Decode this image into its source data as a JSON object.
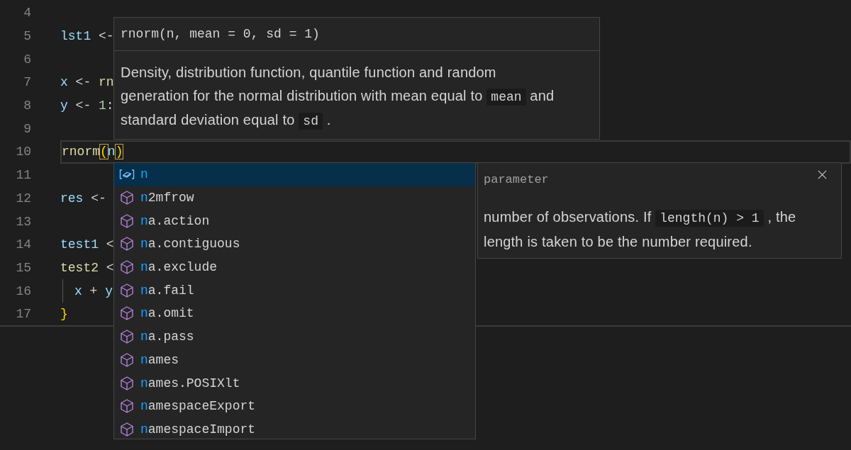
{
  "editor": {
    "lines": [
      {
        "number": "4",
        "current": false,
        "indent": false
      },
      {
        "number": "5",
        "current": false,
        "indent": false,
        "tokens": [
          {
            "text": "lst1",
            "kind": "variable"
          },
          {
            "text": " <-",
            "kind": "operator"
          }
        ]
      },
      {
        "number": "6",
        "current": false,
        "indent": false
      },
      {
        "number": "7",
        "current": false,
        "indent": false,
        "tokens": [
          {
            "text": "x",
            "kind": "variable"
          },
          {
            "text": " <- ",
            "kind": "operator"
          },
          {
            "text": "rn",
            "kind": "function"
          }
        ]
      },
      {
        "number": "8",
        "current": false,
        "indent": false,
        "tokens": [
          {
            "text": "y",
            "kind": "variable"
          },
          {
            "text": " <- ",
            "kind": "operator"
          },
          {
            "text": "1",
            "kind": "number"
          },
          {
            "text": ":",
            "kind": "operator"
          }
        ]
      },
      {
        "number": "9",
        "current": false,
        "indent": false
      },
      {
        "number": "10",
        "current": true,
        "indent": false,
        "tokens": [
          {
            "text": "rnorm",
            "kind": "function"
          },
          {
            "text": "(",
            "kind": "match"
          },
          {
            "text": "n",
            "kind": "variable"
          },
          {
            "text": ")",
            "kind": "match"
          }
        ]
      },
      {
        "number": "11",
        "current": false,
        "indent": false
      },
      {
        "number": "12",
        "current": false,
        "indent": false,
        "tokens": [
          {
            "text": "res",
            "kind": "variable"
          },
          {
            "text": " <-",
            "kind": "operator"
          }
        ]
      },
      {
        "number": "13",
        "current": false,
        "indent": false
      },
      {
        "number": "14",
        "current": false,
        "indent": false,
        "tokens": [
          {
            "text": "test1",
            "kind": "variable"
          },
          {
            "text": " <",
            "kind": "operator"
          }
        ]
      },
      {
        "number": "15",
        "current": false,
        "indent": false,
        "tokens": [
          {
            "text": "test2",
            "kind": "function"
          },
          {
            "text": " <",
            "kind": "operator"
          }
        ]
      },
      {
        "number": "16",
        "current": false,
        "indent": true,
        "tokens": [
          {
            "text": "x",
            "kind": "variable"
          },
          {
            "text": " + ",
            "kind": "operator"
          },
          {
            "text": "y",
            "kind": "variable"
          }
        ]
      },
      {
        "number": "17",
        "current": false,
        "indent": false,
        "tokens": [
          {
            "text": "}",
            "kind": "brace"
          }
        ]
      }
    ]
  },
  "hover": {
    "signature": "rnorm(n, mean = 0, sd = 1)",
    "doc_lines": [
      [
        {
          "kind": "text",
          "text": "Density, distribution function, quantile function and random"
        }
      ],
      [
        {
          "kind": "text",
          "text": "generation for the normal distribution with mean equal to"
        },
        {
          "kind": "code",
          "text": "mean"
        },
        {
          "kind": "text",
          "text": "and"
        }
      ],
      [
        {
          "kind": "text",
          "text": "standard deviation equal to"
        },
        {
          "kind": "code",
          "text": "sd"
        },
        {
          "kind": "text",
          "text": "."
        }
      ]
    ]
  },
  "suggestions": [
    {
      "kind": "variable",
      "match": "n",
      "selected": true
    },
    {
      "kind": "module",
      "match": "n",
      "rest": "2mfrow",
      "selected": false
    },
    {
      "kind": "module",
      "match": "n",
      "rest": "a.action",
      "selected": false
    },
    {
      "kind": "module",
      "match": "n",
      "rest": "a.contiguous",
      "selected": false
    },
    {
      "kind": "module",
      "match": "n",
      "rest": "a.exclude",
      "selected": false
    },
    {
      "kind": "module",
      "match": "n",
      "rest": "a.fail",
      "selected": false
    },
    {
      "kind": "module",
      "match": "n",
      "rest": "a.omit",
      "selected": false
    },
    {
      "kind": "module",
      "match": "n",
      "rest": "a.pass",
      "selected": false
    },
    {
      "kind": "module",
      "match": "n",
      "rest": "ames",
      "selected": false
    },
    {
      "kind": "module",
      "match": "n",
      "rest": "ames.POSIXlt",
      "selected": false
    },
    {
      "kind": "module",
      "match": "n",
      "rest": "amespaceExport",
      "selected": false
    },
    {
      "kind": "module",
      "match": "n",
      "rest": "amespaceImport",
      "selected": false
    }
  ],
  "details": {
    "type": "parameter",
    "doc_lines": [
      [
        {
          "kind": "text",
          "text": "number of observations. If"
        },
        {
          "kind": "code",
          "text": "length(n) > 1"
        },
        {
          "kind": "text",
          "text": ", the"
        }
      ],
      [
        {
          "kind": "text",
          "text": "length is taken to be the number required."
        }
      ]
    ]
  }
}
